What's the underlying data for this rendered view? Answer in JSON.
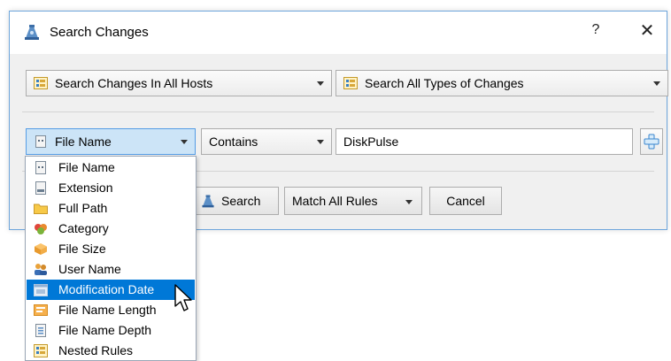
{
  "window": {
    "title": "Search Changes",
    "help_label": "?",
    "close_label": "✕"
  },
  "filters": {
    "hosts_combo": "Search Changes In All Hosts",
    "types_combo": "Search All Types of Changes"
  },
  "rule": {
    "field_combo": "File Name",
    "operator_combo": "Contains",
    "value_input": "DiskPulse"
  },
  "buttons": {
    "search_label": "Search",
    "match_label": "Match All Rules",
    "cancel_label": "Cancel"
  },
  "dropdown": {
    "items": [
      {
        "label": "File Name",
        "icon": "file-icon"
      },
      {
        "label": "Extension",
        "icon": "extension-icon"
      },
      {
        "label": "Full Path",
        "icon": "folder-icon"
      },
      {
        "label": "Category",
        "icon": "category-icon"
      },
      {
        "label": "File Size",
        "icon": "size-icon"
      },
      {
        "label": "User Name",
        "icon": "user-icon"
      },
      {
        "label": "Modification Date",
        "icon": "date-icon"
      },
      {
        "label": "File Name Length",
        "icon": "length-icon"
      },
      {
        "label": "File Name Depth",
        "icon": "depth-icon"
      },
      {
        "label": "Nested Rules",
        "icon": "nested-rules-icon"
      }
    ],
    "selected_index": 6
  },
  "colors": {
    "accent": "#0078d7",
    "dialog_border": "#6ea6dc",
    "active_combo": "#cce4f7"
  }
}
